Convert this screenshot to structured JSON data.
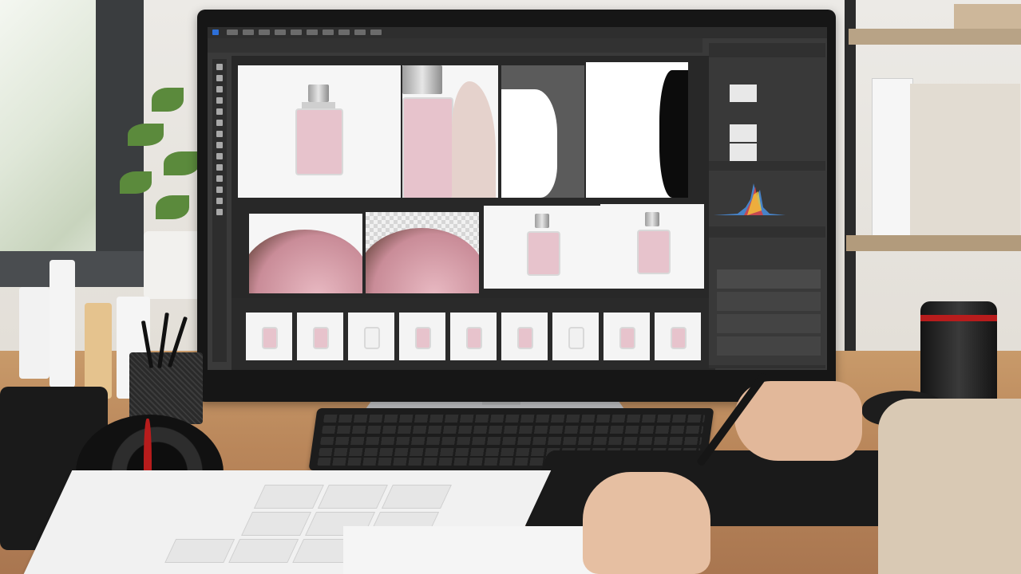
{
  "scene": {
    "description_items": [
      "window-icon",
      "plant-icon",
      "monitor-icon",
      "keyboard-icon",
      "drawing-tablet-icon",
      "stylus-icon",
      "camera-icon",
      "lens-icon",
      "mouse-icon",
      "pen-holder-icon",
      "contact-sheet-icon"
    ]
  },
  "screen": {
    "app": "photo-editor",
    "thumbnail_count": 9,
    "canvas_tiles": 8
  },
  "colors": {
    "desk": "#b9865a",
    "app_bg": "#3a3a3a",
    "perfume_pink": "#e6bec8",
    "lens_accent": "#b71c1c"
  }
}
